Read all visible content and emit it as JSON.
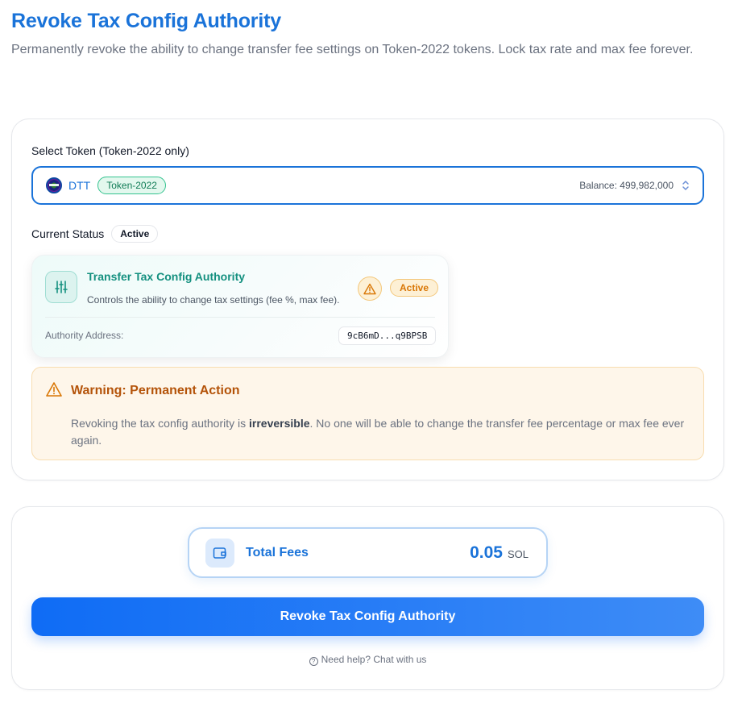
{
  "header": {
    "title": "Revoke Tax Config Authority",
    "subtitle": "Permanently revoke the ability to change transfer fee settings on Token-2022 tokens. Lock tax rate and max fee forever."
  },
  "token_select": {
    "label": "Select Token (Token-2022 only)",
    "symbol": "DTT",
    "badge": "Token-2022",
    "balance": "Balance: 499,982,000"
  },
  "current_status": {
    "label": "Current Status",
    "value": "Active"
  },
  "authority_card": {
    "title": "Transfer Tax Config Authority",
    "description": "Controls the ability to change tax settings (fee %, max fee).",
    "status": "Active",
    "address_label": "Authority Address:",
    "address": "9cB6mD...q9BPSB"
  },
  "warning": {
    "title": "Warning: Permanent Action",
    "text_before": "Revoking the tax config authority is ",
    "text_bold": "irreversible",
    "text_after": ". No one will be able to change the transfer fee percentage or max fee ever again."
  },
  "fees": {
    "label": "Total Fees",
    "value": "0.05",
    "unit": "SOL"
  },
  "actions": {
    "revoke_label": "Revoke Tax Config Authority",
    "help_label": "Need help? Chat with us"
  },
  "colors": {
    "accent": "#1a73d9",
    "teal": "#14907f",
    "warning": "#b45309",
    "warning_bg": "#fef6ea"
  }
}
